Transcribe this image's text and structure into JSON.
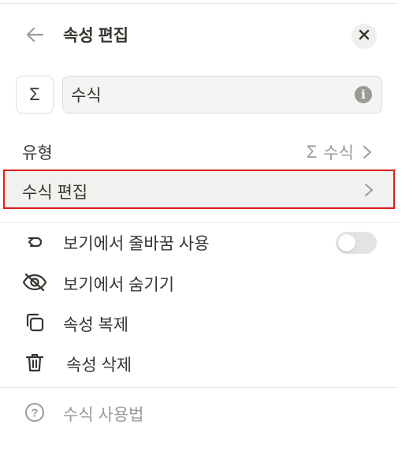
{
  "header": {
    "title": "속성 편집",
    "back_icon": "arrow-left-icon",
    "close_icon": "close-icon"
  },
  "property": {
    "type_glyph": "Σ",
    "name_value": "수식",
    "info_glyph": "i"
  },
  "type_row": {
    "label": "유형",
    "value_glyph": "Σ",
    "value": "수식"
  },
  "formula_row": {
    "label": "수식 편집"
  },
  "menu": {
    "wrap_label": "보기에서 줄바꿈 사용",
    "wrap_enabled": false,
    "hide_label": "보기에서 숨기기",
    "duplicate_label": "속성 복제",
    "delete_label": "속성 삭제"
  },
  "help": {
    "label": "수식 사용법",
    "glyph": "?"
  },
  "colors": {
    "highlight_border": "#e11d1d",
    "text": "#37352f",
    "muted": "#9b9a97"
  }
}
